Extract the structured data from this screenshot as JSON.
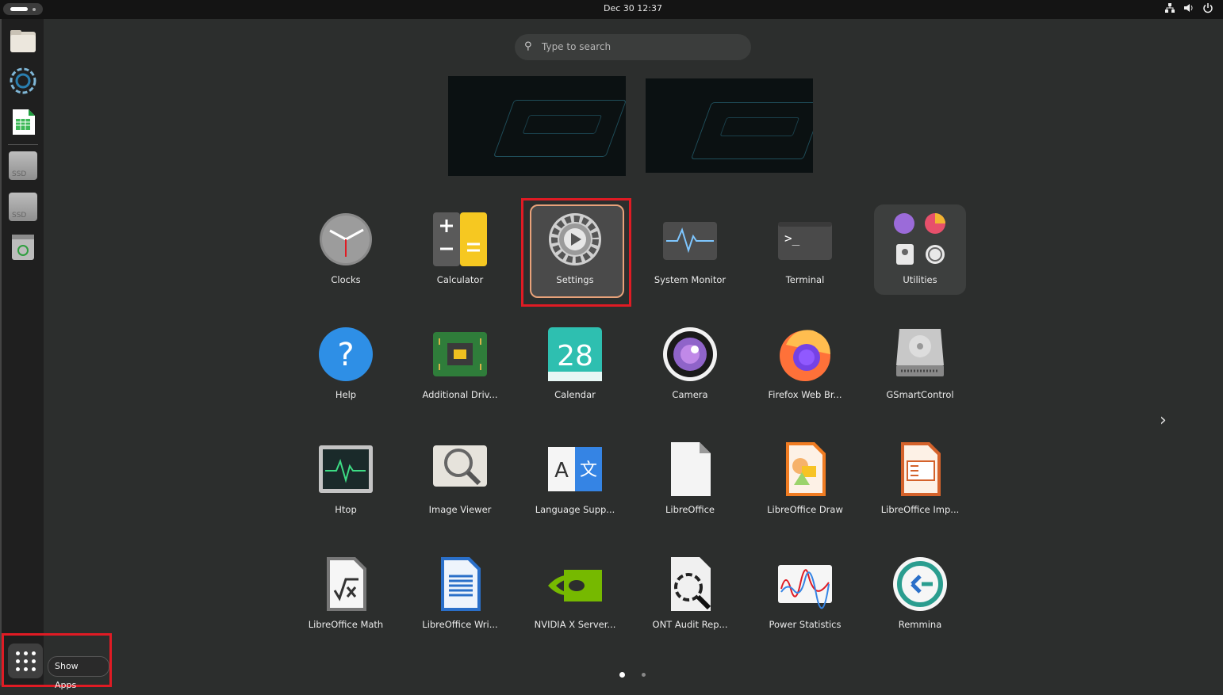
{
  "topbar": {
    "datetime": "Dec 30  12:37"
  },
  "search": {
    "placeholder": "Type to search"
  },
  "dash": {
    "ssd1": "SSD",
    "ssd2": "SSD",
    "show_apps_label": "Show Apps"
  },
  "apps": [
    {
      "label": "Clocks"
    },
    {
      "label": "Calculator"
    },
    {
      "label": "Settings"
    },
    {
      "label": "System Monitor"
    },
    {
      "label": "Terminal"
    },
    {
      "label": "Utilities"
    },
    {
      "label": "Help"
    },
    {
      "label": "Additional Driv..."
    },
    {
      "label": "Calendar"
    },
    {
      "label": "Camera"
    },
    {
      "label": "Firefox Web Br..."
    },
    {
      "label": "GSmartControl"
    },
    {
      "label": "Htop"
    },
    {
      "label": "Image Viewer"
    },
    {
      "label": "Language Supp..."
    },
    {
      "label": "LibreOffice"
    },
    {
      "label": "LibreOffice Draw"
    },
    {
      "label": "LibreOffice Imp..."
    },
    {
      "label": "LibreOffice Math"
    },
    {
      "label": "LibreOffice Wri..."
    },
    {
      "label": "NVIDIA X Server..."
    },
    {
      "label": "ONT Audit Rep..."
    },
    {
      "label": "Power Statistics"
    },
    {
      "label": "Remmina"
    }
  ],
  "calendar_day": "28",
  "terminal_prompt": ">_",
  "help_glyph": "?",
  "language_glyphs": {
    "left": "A",
    "right": "文"
  }
}
